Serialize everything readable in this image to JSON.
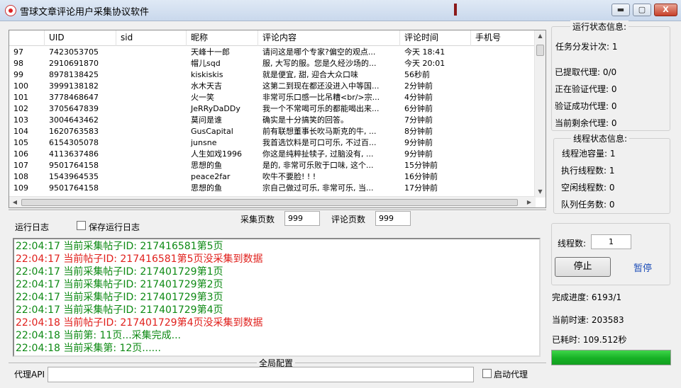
{
  "window": {
    "title": "雪球文章评论用户采集协议软件",
    "min_glyph": "▬",
    "max_glyph": "▢",
    "close_glyph": "X"
  },
  "table": {
    "columns": [
      "",
      "UID",
      "sid",
      "昵称",
      "评论内容",
      "评论时间",
      "手机号"
    ],
    "rows": [
      [
        "97",
        "7423053705",
        "",
        "天峰十一郎",
        "请问这是哪个专家?偏空的观点...",
        "今天 18:41",
        ""
      ],
      [
        "98",
        "2910691870",
        "",
        "帽儿sqd",
        "服, 大写的服。您是久经沙场的...",
        "今天 20:01",
        ""
      ],
      [
        "99",
        "8978138425",
        "",
        "kiskiskis",
        "就是便宜, 甜, 迎合大众口味",
        "56秒前",
        ""
      ],
      [
        "100",
        "3999138182",
        "",
        "水木天吉",
        "这第二到现在都还没进入中等国...",
        "2分钟前",
        ""
      ],
      [
        "101",
        "3778468647",
        "",
        "火一笑",
        "非常可乐口感一比吊糟<br/>宗...",
        "4分钟前",
        ""
      ],
      [
        "102",
        "3705647839",
        "",
        "JeRRyDaDDy",
        "我一个不常喝可乐的都能喝出来...",
        "6分钟前",
        ""
      ],
      [
        "103",
        "3004643462",
        "",
        "莫问是谁",
        "确实是十分搞笑的回答。",
        "7分钟前",
        ""
      ],
      [
        "104",
        "1620763583",
        "",
        "GusCapital",
        "前有联想董事长吹马斯克的牛, ...",
        "8分钟前",
        ""
      ],
      [
        "105",
        "6154305078",
        "",
        "junsne",
        "我首选饮料是可口可乐, 不过百...",
        "9分钟前",
        ""
      ],
      [
        "106",
        "4113637486",
        "",
        "人生如戏1996",
        "你这是纯粹扯犊子, 过脑没有, ...",
        "9分钟前",
        ""
      ],
      [
        "107",
        "9501764158",
        "",
        "思想的鱼",
        "是的, 非常可乐败于口味, 这个...",
        "15分钟前",
        ""
      ],
      [
        "108",
        "1543964535",
        "",
        "peace2far",
        "吹牛不要脸! ! !",
        "16分钟前",
        ""
      ],
      [
        "109",
        "9501764158",
        "",
        "思想的鱼",
        "宗自己做过可乐, 非常可乐, 当...",
        "17分钟前",
        ""
      ]
    ]
  },
  "controls": {
    "log_label": "运行日志",
    "save_log_label": "保存运行日志",
    "collect_pages_label": "采集页数",
    "collect_pages_value": "999",
    "comment_pages_label": "评论页数",
    "comment_pages_value": "999"
  },
  "log": [
    {
      "text": "22:04:17 当前采集帖子ID: 217416581第5页",
      "level": "info"
    },
    {
      "text": "22:04:17 当前帖子ID: 217416581第5页没采集到数据",
      "level": "error"
    },
    {
      "text": "22:04:17 当前采集帖子ID: 217401729第1页",
      "level": "info"
    },
    {
      "text": "22:04:17 当前采集帖子ID: 217401729第2页",
      "level": "info"
    },
    {
      "text": "22:04:17 当前采集帖子ID: 217401729第3页",
      "level": "info"
    },
    {
      "text": "22:04:17 当前采集帖子ID: 217401729第4页",
      "level": "info"
    },
    {
      "text": "22:04:18 当前帖子ID: 217401729第4页没采集到数据",
      "level": "error"
    },
    {
      "text": "22:04:18 当前第: 11页...采集完成...",
      "level": "info"
    },
    {
      "text": "22:04:18 当前采集第: 12页......",
      "level": "info"
    }
  ],
  "global_config": {
    "title": "全局配置",
    "proxy_api_label": "代理API",
    "proxy_api_value": "",
    "enable_proxy_label": "启动代理"
  },
  "run_status": {
    "title": "运行状态信息:",
    "task_dispatch": "任务分发计次: 1",
    "proxy_fetched": "已提取代理: 0/0",
    "proxy_verifying": "正在验证代理: 0",
    "proxy_verified": "验证成功代理: 0",
    "proxy_remaining": "当前剩余代理: 0"
  },
  "thread_status": {
    "title": "线程状态信息:",
    "pool_capacity": "线程池容量: 1",
    "running": "执行线程数: 1",
    "idle": "空闲线程数: 0",
    "queued": "队列任务数: 0"
  },
  "thread_control": {
    "thread_count_label": "线程数:",
    "thread_count_value": "1",
    "stop_label": "停止",
    "pause_label": "暂停"
  },
  "stats": {
    "progress": "完成进度: 6193/1",
    "speed": "当前时速: 203583",
    "elapsed": "已耗时: 109.512秒",
    "progress_fraction": 1.0
  },
  "colors": {
    "log_info": "#0e8a14",
    "log_error": "#e0201c",
    "progress_fill": "#16b025",
    "pause_link": "#1f4fb8"
  }
}
